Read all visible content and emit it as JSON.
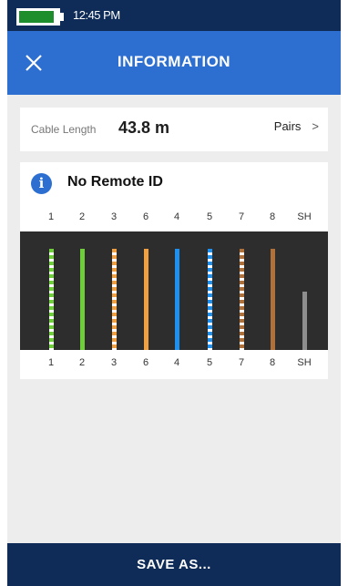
{
  "status": {
    "time": "12:45 PM",
    "battery_percent": 90,
    "battery_color": "#1e8e2c"
  },
  "header": {
    "title": "INFORMATION",
    "close_icon": "close-icon",
    "bg_color": "#2c6fd1"
  },
  "cable": {
    "length_label": "Cable Length",
    "length_value": "43.8 m",
    "pairs_label": "Pairs",
    "pairs_chevron": ">"
  },
  "remote": {
    "icon": "info-icon",
    "icon_glyph": "i",
    "title": "No Remote ID"
  },
  "wiremap": {
    "labels_top": [
      "1",
      "2",
      "3",
      "6",
      "4",
      "5",
      "7",
      "8",
      "SH"
    ],
    "labels_bottom": [
      "1",
      "2",
      "3",
      "6",
      "4",
      "5",
      "7",
      "8",
      "SH"
    ],
    "wires": [
      {
        "color": "#6fcf3a",
        "stripe": true,
        "level": 0.85
      },
      {
        "color": "#6fcf3a",
        "stripe": false,
        "level": 0.85
      },
      {
        "color": "#f0a040",
        "stripe": true,
        "level": 0.85
      },
      {
        "color": "#f0a040",
        "stripe": false,
        "level": 0.85
      },
      {
        "color": "#1e90f0",
        "stripe": false,
        "level": 0.85
      },
      {
        "color": "#1e90f0",
        "stripe": true,
        "level": 0.85
      },
      {
        "color": "#b0703a",
        "stripe": true,
        "level": 0.85
      },
      {
        "color": "#b0703a",
        "stripe": false,
        "level": 0.85
      },
      {
        "color": "#8e8e8e",
        "stripe": false,
        "level": 0.49
      }
    ]
  },
  "footer": {
    "save_label": "SAVE AS..."
  }
}
